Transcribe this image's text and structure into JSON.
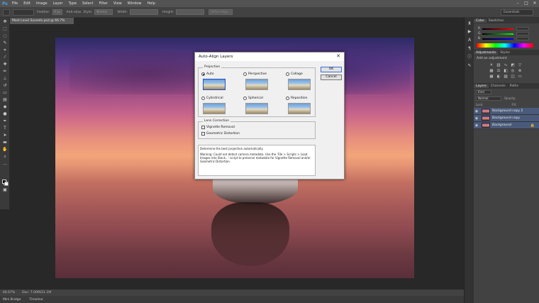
{
  "menubar": {
    "logo": "Ps",
    "items": [
      "File",
      "Edit",
      "Image",
      "Layer",
      "Type",
      "Select",
      "Filter",
      "View",
      "Window",
      "Help"
    ]
  },
  "optionsbar": {
    "feather_label": "Feather:",
    "feather_value": "0 px",
    "antialias_label": "Anti-alias",
    "style_label": "Style:",
    "style_value": "Normal",
    "width_label": "Width:",
    "height_label": "Height:",
    "refine_label": "Refine Edge...",
    "workspace": "Essentials"
  },
  "document": {
    "tab_title": "Most Level Sunsets.psd @ 66.7% (RGB/8#) *",
    "zoom": "66.67%",
    "doc_size": "Doc: 7.00M/21.1M"
  },
  "bottomtabs": [
    "Mini Bridge",
    "Timeline"
  ],
  "panels": {
    "color_tabs": [
      "Color",
      "Swatches"
    ],
    "color_slider_labels": [
      "R",
      "G",
      "B"
    ],
    "adjustments_tabs": [
      "Adjustments",
      "Styles"
    ],
    "adjustments_hint": "Add an adjustment",
    "layers_tabs": [
      "Layers",
      "Channels",
      "Paths"
    ],
    "kind_label": "Kind",
    "blend_mode": "Normal",
    "opacity_label": "Opacity:",
    "lock_label": "Lock:",
    "fill_label": "Fill:",
    "layers": [
      {
        "name": "Background copy 2"
      },
      {
        "name": "Background copy"
      },
      {
        "name": "Background"
      }
    ]
  },
  "dialog": {
    "title": "Auto-Align Layers",
    "projection_legend": "Projection",
    "options": [
      "Auto",
      "Perspective",
      "Collage",
      "Cylindrical",
      "Spherical",
      "Reposition"
    ],
    "selected": "Auto",
    "lens_legend": "Lens Correction",
    "vignette": "Vignette Removal",
    "distortion": "Geometric Distortion",
    "ok": "OK",
    "cancel": "Cancel",
    "info_line1": "Determine the best projection automatically.",
    "info_line2": "Warning: Could not detect camera metadata. Use the 'File > Scripts > Load Images into Stack...' script to preserve metadata for Vignette Removal and/or Geometric Distortion."
  }
}
